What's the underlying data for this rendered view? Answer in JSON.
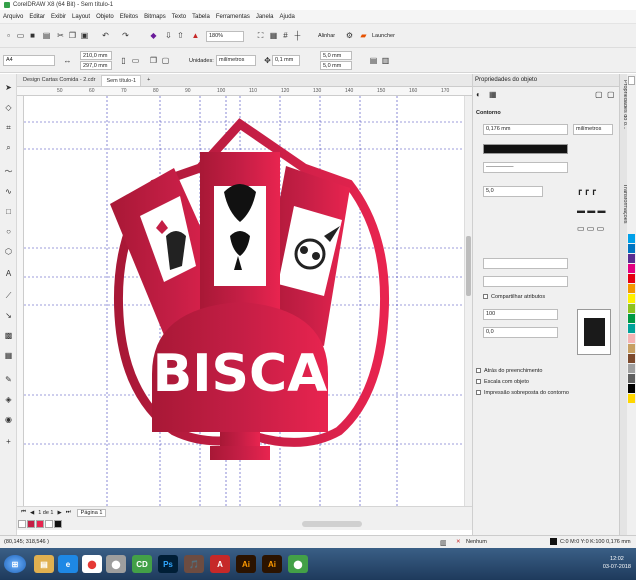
{
  "window": {
    "title": "CorelDRAW X8 (64 Bit) - Sem título-1"
  },
  "menu": [
    "Arquivo",
    "Editar",
    "Exibir",
    "Layout",
    "Objeto",
    "Efeitos",
    "Bitmaps",
    "Texto",
    "Tabela",
    "Ferramentas",
    "Janela",
    "Ajuda"
  ],
  "toolbar": {
    "zoom": "180%",
    "snap_label": "Alinhar",
    "launcher_label": "Launcher"
  },
  "propbar": {
    "page_size": "A4",
    "width": "210,0 mm",
    "height": "297,0 mm",
    "units_label": "Unidades:",
    "units_value": "milímetros",
    "nudge": "0,1 mm",
    "dup_x": "5,0 mm",
    "dup_y": "5,0 mm"
  },
  "tabs": [
    {
      "label": "Design Cartas Comida - 2.cdr"
    },
    {
      "label": "Sem título-1"
    }
  ],
  "ruler_numbers": [
    "50",
    "60",
    "70",
    "80",
    "90",
    "100",
    "110",
    "120",
    "130",
    "140",
    "150",
    "160",
    "170"
  ],
  "canvas": {
    "logo_text": "BISCA",
    "logo_color": "#c41e45"
  },
  "pagenav": {
    "position": "1 de 1",
    "page_tab": "Página 1"
  },
  "panel": {
    "title": "Propriedades do objeto",
    "section": "Contorno",
    "outline_width": "0,176 mm",
    "outline_units": "milímetros",
    "corner_value": "5,0",
    "end_value_1": "100",
    "end_value_2": "0,0",
    "share_label": "Compartilhar atributos",
    "behind_fill": "Atrás do preenchimento",
    "scale_with_object": "Escala com objeto",
    "overprint": "Impressão sobreposta do contorno",
    "swatch_color": "#1a1a1a"
  },
  "side_tabs": [
    "Propriedades do o...",
    "Transformações"
  ],
  "status": {
    "coords": "(80,145; 318,546 )",
    "fill_label": "Nenhum",
    "outline_info": "C:0 M:0 Y:0 K:100  0,176 mm"
  },
  "taskbar": {
    "time": "12:02",
    "date": "03-07-2018",
    "apps": [
      "e",
      "⬤",
      "⬤",
      "CD",
      "Ps",
      "🎵",
      "A",
      "Ai",
      "Ai",
      "⬤"
    ]
  },
  "colors": {
    "red": "#c41e45",
    "palette": [
      "#ffffff",
      "#000000",
      "#00a0e9",
      "#0075c2",
      "#5a2d91",
      "#e4007f",
      "#e60012",
      "#f39800",
      "#fff100",
      "#8fc31f",
      "#009944",
      "#00a29a",
      "#a0a0a0",
      "#606060",
      "#f5b2b2",
      "#c8a063",
      "#7d4a2d",
      "#ffd700"
    ]
  }
}
